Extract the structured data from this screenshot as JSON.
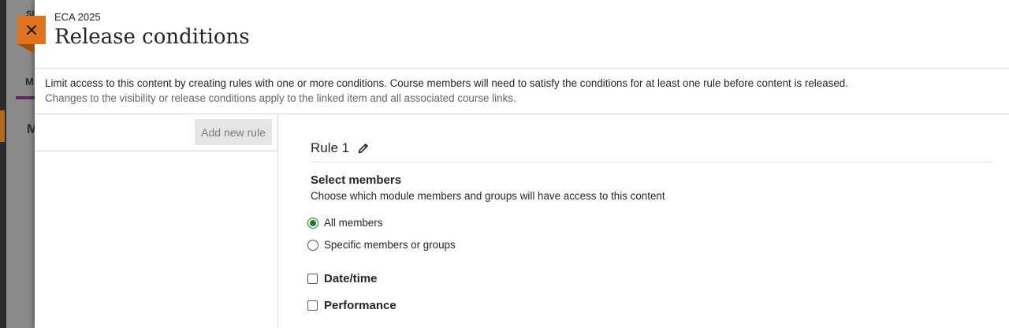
{
  "panel": {
    "course_name": "ECA 2025",
    "title": "Release conditions",
    "description": "Limit access to this content by creating rules with one or more conditions. Course members will need to satisfy the conditions for at least one rule before content is released.",
    "note": "Changes to the visibility or release conditions apply to the linked item and all associated course links."
  },
  "left": {
    "add_rule_label": "Add new rule"
  },
  "rule": {
    "title": "Rule 1",
    "members_title": "Select members",
    "members_help": "Choose which module members and groups will have access to this content",
    "options": [
      {
        "label": "All members",
        "checked": true
      },
      {
        "label": "Specific members or groups",
        "checked": false
      }
    ],
    "conditions": [
      {
        "label": "Date/time",
        "checked": false
      },
      {
        "label": "Performance",
        "checked": false
      }
    ]
  },
  "background": {
    "tab_letter": "M",
    "heading_letter": "M",
    "top_letters": "SI"
  },
  "colors": {
    "accent_orange": "#e0731d",
    "radio_green": "#1a7f2a"
  }
}
